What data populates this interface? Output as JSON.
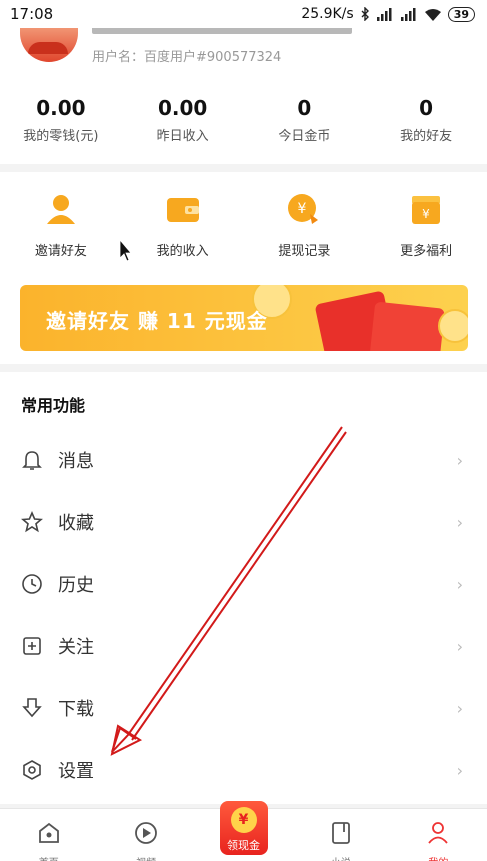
{
  "status_bar": {
    "time": "17:08",
    "network_speed": "25.9K/s",
    "battery": "39",
    "icons": [
      "bluetooth-icon",
      "signal-icon",
      "signal-icon",
      "wifi-icon",
      "battery-icon"
    ]
  },
  "profile": {
    "username": "用户名：百度用户#900577324"
  },
  "stats": [
    {
      "value": "0.00",
      "label": "我的零钱(元)"
    },
    {
      "value": "0.00",
      "label": "昨日收入"
    },
    {
      "value": "0",
      "label": "今日金币"
    },
    {
      "value": "0",
      "label": "我的好友"
    }
  ],
  "quick_actions": [
    {
      "label": "邀请好友",
      "icon": "invite-friend-icon"
    },
    {
      "label": "我的收入",
      "icon": "wallet-icon"
    },
    {
      "label": "提现记录",
      "icon": "withdraw-record-icon"
    },
    {
      "label": "更多福利",
      "icon": "gift-icon"
    }
  ],
  "banner": {
    "text": "邀请好友 赚 11 元现金"
  },
  "common_functions": {
    "title": "常用功能",
    "items": [
      {
        "label": "消息",
        "icon": "bell-icon"
      },
      {
        "label": "收藏",
        "icon": "star-icon"
      },
      {
        "label": "历史",
        "icon": "clock-icon"
      },
      {
        "label": "关注",
        "icon": "add-follow-icon"
      },
      {
        "label": "下载",
        "icon": "download-icon"
      },
      {
        "label": "设置",
        "icon": "settings-icon"
      }
    ],
    "chevron": "›"
  },
  "tab_bar": {
    "tabs": [
      {
        "label": "首页",
        "icon": "home-icon"
      },
      {
        "label": "视频",
        "icon": "play-icon"
      },
      {
        "label": "领现金",
        "icon": "cash-coin-icon"
      },
      {
        "label": "小说",
        "icon": "book-icon"
      },
      {
        "label": "我的",
        "icon": "profile-icon"
      }
    ],
    "cash_symbol": "¥"
  },
  "colors": {
    "accent_red": "#e8302a",
    "banner_yellow": "#fbb32c",
    "annotation_arrow": "#d21a1a"
  }
}
